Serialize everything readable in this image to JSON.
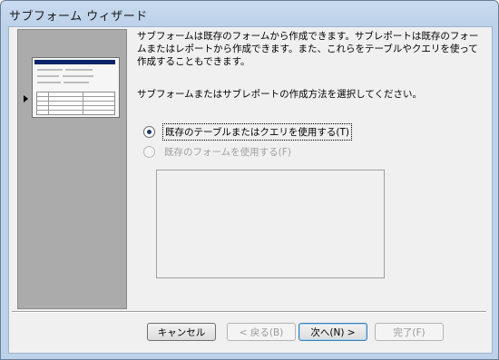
{
  "window": {
    "title": "サブフォーム ウィザード"
  },
  "description": "サブフォームは既存のフォームから作成できます。サブレポートは既存のフォームまたはレポートから作成できます。また、これらをテーブルやクエリを使って作成することもできます。",
  "prompt": "サブフォームまたはサブレポートの作成方法を選択してください。",
  "options": [
    {
      "label": "既存のテーブルまたはクエリを使用する(T)",
      "checked": true,
      "enabled": true
    },
    {
      "label": "既存のフォームを使用する(F)",
      "checked": false,
      "enabled": false
    }
  ],
  "buttons": {
    "cancel": "キャンセル",
    "back": "< 戻る(B)",
    "next": "次へ(N) >",
    "finish": "完了(F)"
  }
}
